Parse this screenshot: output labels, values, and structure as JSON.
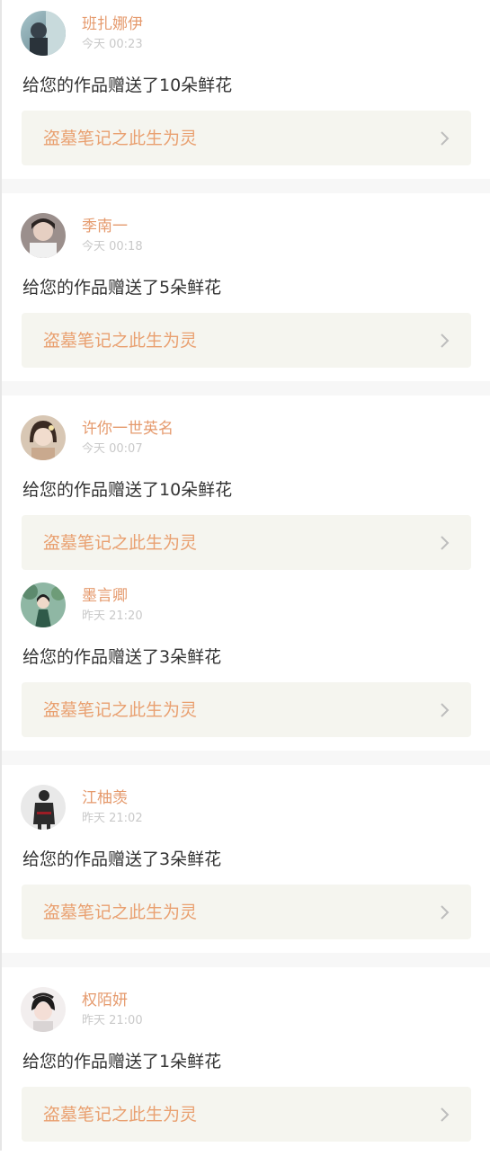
{
  "colors": {
    "username": "#e59a6d",
    "time": "#c9c9c9",
    "message": "#333333",
    "card_bg": "#f5f5ef",
    "card_title": "#e9a070",
    "divider": "#f7f7f7"
  },
  "notifications": [
    {
      "username": "班扎娜伊",
      "time": "今天 00:23",
      "message": "给您的作品赠送了10朵鲜花",
      "work_title": "盗墓笔记之此生为灵",
      "avatar_icon": "avatar-icon"
    },
    {
      "username": "季南一",
      "time": "今天 00:18",
      "message": "给您的作品赠送了5朵鲜花",
      "work_title": "盗墓笔记之此生为灵",
      "avatar_icon": "avatar-icon"
    },
    {
      "username": "许你一世英名",
      "time": "今天 00:07",
      "message": "给您的作品赠送了10朵鲜花",
      "work_title": "盗墓笔记之此生为灵",
      "avatar_icon": "avatar-icon"
    },
    {
      "username": "墨言卿",
      "time": "昨天 21:20",
      "message": "给您的作品赠送了3朵鲜花",
      "work_title": "盗墓笔记之此生为灵",
      "avatar_icon": "avatar-icon"
    },
    {
      "username": "江柚羡",
      "time": "昨天 21:02",
      "message": "给您的作品赠送了3朵鲜花",
      "work_title": "盗墓笔记之此生为灵",
      "avatar_icon": "avatar-icon"
    },
    {
      "username": "权陌妍",
      "time": "昨天 21:00",
      "message": "给您的作品赠送了1朵鲜花",
      "work_title": "盗墓笔记之此生为灵",
      "avatar_icon": "avatar-icon"
    }
  ]
}
